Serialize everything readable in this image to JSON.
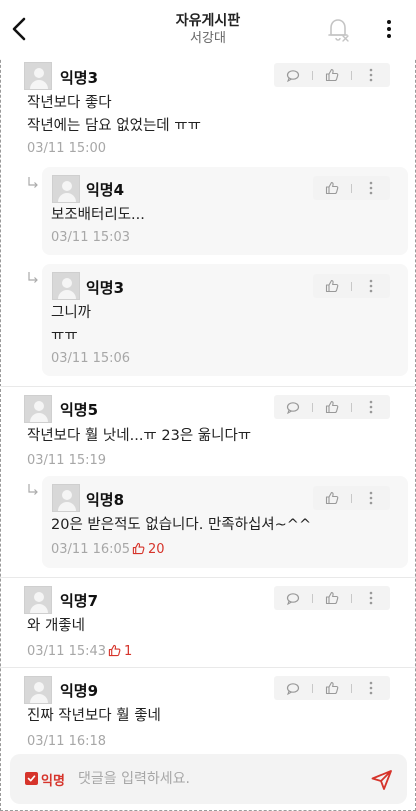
{
  "header": {
    "title": "자유게시판",
    "subtitle": "서강대"
  },
  "comments": [
    {
      "nick": "익명3",
      "text": "작년보다 좋다\n작년에는 담요 없었는데 ㅠㅠ",
      "time": "03/11 15:00",
      "likes": ""
    },
    {
      "nick": "익명4",
      "text": "보조배터리도...",
      "time": "03/11 15:03",
      "likes": ""
    },
    {
      "nick": "익명3",
      "text": "그니까\nㅠㅠ",
      "time": "03/11 15:06",
      "likes": ""
    },
    {
      "nick": "익명5",
      "text": "작년보다 훨 낫네...ㅠ 23은 욺니다ㅠ",
      "time": "03/11 15:19",
      "likes": ""
    },
    {
      "nick": "익명8",
      "text": "20은 받은적도 없습니다. 만족하십셔~^^",
      "time": "03/11 16:05",
      "likes": "20"
    },
    {
      "nick": "익명7",
      "text": "와 개좋네",
      "time": "03/11 15:43",
      "likes": "1"
    },
    {
      "nick": "익명9",
      "text": "진짜 작년보다 훨 좋네",
      "time": "03/11 16:18",
      "likes": ""
    }
  ],
  "input": {
    "anon_label": "익명",
    "placeholder": "댓글을 입력하세요."
  },
  "colors": {
    "accent": "#d6342b",
    "meta": "#a7a7a7",
    "reply_bg": "#f7f7f7"
  }
}
